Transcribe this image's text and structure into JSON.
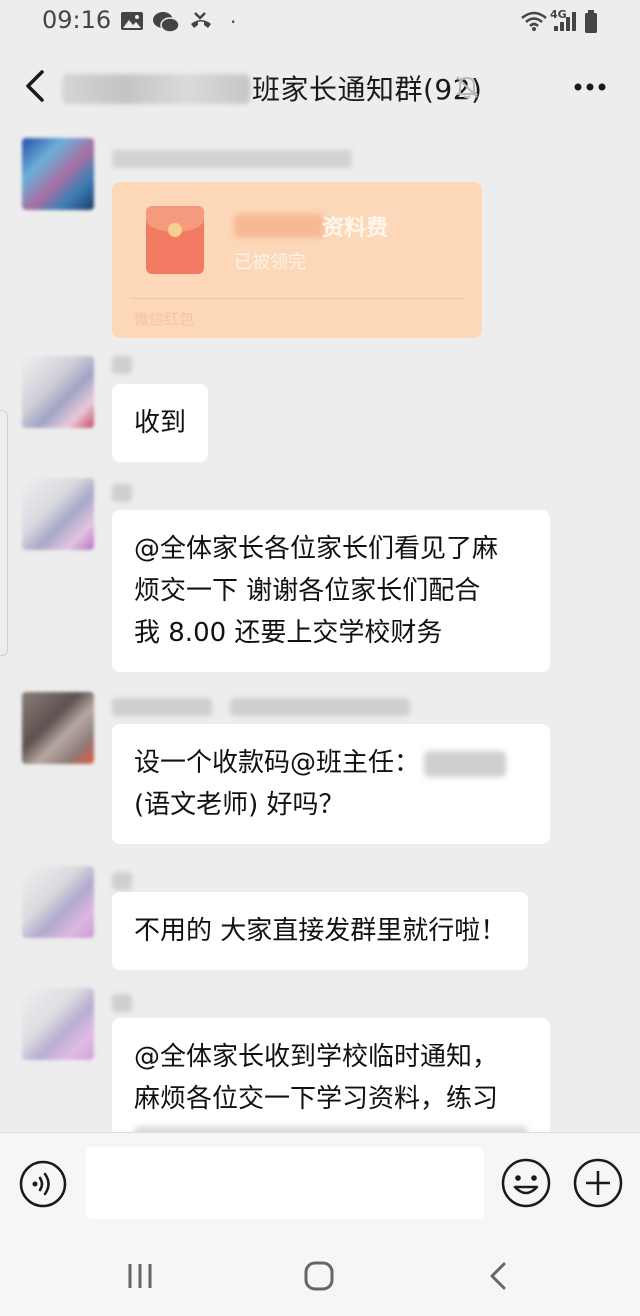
{
  "status_bar": {
    "time": "09:16",
    "network": "4G"
  },
  "header": {
    "title": "班家长通知群(92)"
  },
  "messages": [
    {
      "type": "red_packet",
      "title": "资料费",
      "status": "已被领完",
      "footer": "微信红包"
    },
    {
      "type": "text",
      "text": "收到"
    },
    {
      "type": "text",
      "lines": [
        "@全体家长各位家长们看见了麻",
        "烦交一下  谢谢各位家长们配合",
        "我 8.00 还要上交学校财务"
      ]
    },
    {
      "type": "text",
      "lines": [
        "设一个收款码@班主任：",
        "(语文老师)  好吗？"
      ]
    },
    {
      "type": "text",
      "text": "不用的 大家直接发群里就行啦！"
    },
    {
      "type": "text",
      "lines": [
        "@全体家长收到学校临时通知，",
        "麻烦各位交一下学习资料，练习"
      ]
    }
  ],
  "colors": {
    "background": "#ededed",
    "bubble": "#ffffff",
    "red_packet": "#fcd8b8",
    "red_packet_icon": "#f27a62"
  },
  "icons": {
    "back": "chevron-left-icon",
    "mute": "bell-off-icon",
    "more": "more-dots-icon",
    "voice": "voice-icon",
    "emoji": "emoji-icon",
    "plus": "plus-circle-icon"
  }
}
